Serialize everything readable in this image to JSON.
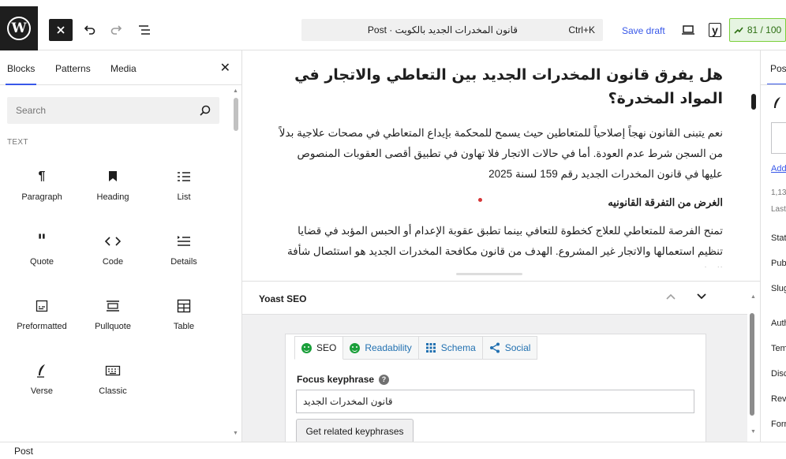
{
  "toolbar": {
    "logo": "W",
    "command_title": "Post · قانون المخدرات الجديد بالكويت",
    "command_shortcut": "Ctrl+K",
    "save_draft": "Save draft",
    "yoast_icon": "y",
    "score": "81 / 100",
    "icons": [
      "close-icon",
      "undo-icon",
      "redo-icon",
      "document-overview-icon",
      "preview-icon",
      "yoast-icon",
      "seo-score-icon"
    ]
  },
  "inserter": {
    "tabs": [
      "Blocks",
      "Patterns",
      "Media"
    ],
    "active_tab": "Blocks",
    "search_placeholder": "Search",
    "section": "TEXT",
    "blocks": [
      {
        "label": "Paragraph",
        "icon": "paragraph-icon"
      },
      {
        "label": "Heading",
        "icon": "heading-icon"
      },
      {
        "label": "List",
        "icon": "list-icon"
      },
      {
        "label": "Quote",
        "icon": "quote-icon"
      },
      {
        "label": "Code",
        "icon": "code-icon"
      },
      {
        "label": "Details",
        "icon": "details-icon"
      },
      {
        "label": "Preformatted",
        "icon": "preformatted-icon"
      },
      {
        "label": "Pullquote",
        "icon": "pullquote-icon"
      },
      {
        "label": "Table",
        "icon": "table-icon"
      },
      {
        "label": "Verse",
        "icon": "verse-icon"
      },
      {
        "label": "Classic",
        "icon": "classic-icon"
      }
    ]
  },
  "editor": {
    "title": "هل يفرق قانون المخدرات الجديد بين التعاطي والاتجار في المواد المخدرة؟",
    "paragraph1": "نعم يتبنى القانون نهجاً إصلاحياً للمتعاطين حيث يسمح للمحكمة بإيداع المتعاطي في مصحات علاجية بدلاً من السجن شرط عدم العودة. أما في حالات الاتجار فلا تهاون في تطبيق أقصى العقوبات المنصوص عليها في قانون المخدرات الجديد رقم 159 لسنة 2025",
    "subheading": "الغرض من التفرقة القانونيه",
    "paragraph2": "تمنح الفرصة للمتعاطي للعلاج كخطوة للتعافي بينما تطبق عقوبة الإعدام أو الحبس المؤبد في قضايا تنظيم استعمالها والاتجار غير المشروع. الهدف من قانون مكافحة المخدرات الجديد هو استئصال شأفة المتاجرين"
  },
  "yoast": {
    "title": "Yoast SEO",
    "tabs": [
      {
        "label": "SEO",
        "icon": "smiley-good-icon"
      },
      {
        "label": "Readability",
        "icon": "smiley-good-icon"
      },
      {
        "label": "Schema",
        "icon": "grid-icon"
      },
      {
        "label": "Social",
        "icon": "share-icon"
      }
    ],
    "focus_label": "Focus keyphrase",
    "help": "?",
    "focus_value": "قانون المخدرات الجديد",
    "related_button": "Get related keyphrases"
  },
  "settings": {
    "tab": "Post",
    "add": "Add",
    "count": "1,13",
    "last": "Last",
    "rows": [
      "Stat",
      "Pub",
      "Slug",
      "Auth",
      "Tem",
      "Disc",
      "Revi",
      "Forr"
    ]
  },
  "footer": {
    "breadcrumb": "Post"
  },
  "colors": {
    "accent": "#3858e9",
    "score_green": "#7ad03a",
    "dark": "#1e1e1e"
  }
}
